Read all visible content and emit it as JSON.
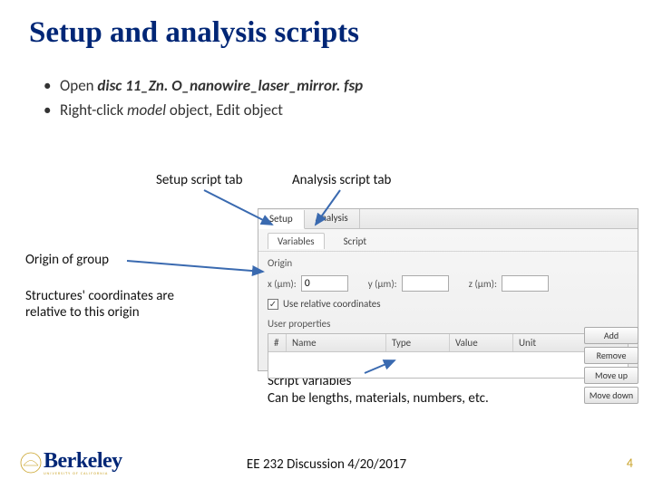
{
  "title": "Setup and analysis scripts",
  "bullets": {
    "b1_prefix": "Open ",
    "b1_file": "disc 11_Zn. O_nanowire_laser_mirror. fsp",
    "b2_prefix": "Right-click ",
    "b2_model": "model",
    "b2_suffix": " object, Edit object"
  },
  "tab_labels": {
    "setup": "Setup script tab",
    "analysis": "Analysis script tab"
  },
  "annotations": {
    "origin_title": "Origin of group",
    "structures_line1": "Structures' coordinates are",
    "structures_line2": "relative to this origin",
    "script_vars_line1": "Script variables",
    "script_vars_line2": "Can be lengths, materials, numbers, etc."
  },
  "screenshot": {
    "tab1": "Setup",
    "tab2": "Analysis",
    "subtab1": "Variables",
    "subtab2": "Script",
    "origin_label": "Origin",
    "x_label": "x (µm):",
    "y_label": "y (µm):",
    "z_label": "z (µm):",
    "x_val": "0",
    "y_val": "",
    "z_val": "",
    "relative_checkbox": "Use relative coordinates",
    "user_props": "User properties",
    "col_num": "#",
    "col_name": "Name",
    "col_type": "Type",
    "col_value": "Value",
    "col_unit": "Unit",
    "btn_add": "Add",
    "btn_remove": "Remove",
    "btn_moveup": "Move up",
    "btn_movedown": "Move down"
  },
  "footer": {
    "center": "EE 232 Discussion 4/20/2017",
    "slide_num": "4"
  },
  "logo": {
    "text": "Berkeley",
    "sub": "UNIVERSITY OF CALIFORNIA"
  }
}
